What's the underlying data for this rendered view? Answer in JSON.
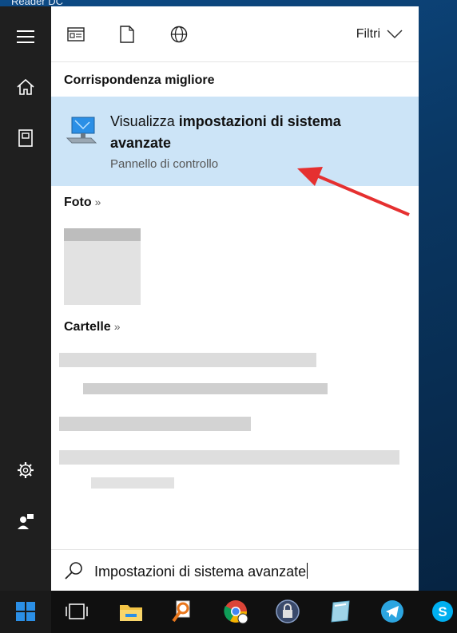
{
  "window": {
    "desktop_label": "Reader DC"
  },
  "rail": {
    "items": [
      {
        "icon": "hamburger-icon"
      },
      {
        "icon": "home-icon"
      },
      {
        "icon": "documents-icon"
      },
      {
        "icon": "settings-gear-icon"
      },
      {
        "icon": "user-feedback-icon"
      }
    ]
  },
  "toolbar": {
    "icons": [
      "apps-icon",
      "document-icon",
      "web-globe-icon"
    ],
    "filter_label": "Filtri"
  },
  "results": {
    "best_match_header": "Corrispondenza migliore",
    "best_match": {
      "title_plain": "Visualizza ",
      "title_bold": "impostazioni di sistema avanzate",
      "subtitle": "Pannello di controllo",
      "icon": "computer-settings-icon"
    },
    "photos_header": "Foto",
    "photos_chev": "»",
    "folders_header": "Cartelle",
    "folders_chev": "»"
  },
  "search": {
    "value": "Impostazioni di sistema avanzate",
    "icon": "search-icon"
  },
  "taskbar": {
    "apps": [
      "start-icon",
      "task-view-icon",
      "file-explorer-icon",
      "search-magnifier-app-icon",
      "chrome-icon",
      "vpn-lock-icon",
      "notes-icon",
      "telegram-icon",
      "skype-icon"
    ]
  },
  "colors": {
    "accent_selection": "#cce4f7",
    "annotation_arrow": "#e53030",
    "start_blue": "#2b8fe6"
  }
}
